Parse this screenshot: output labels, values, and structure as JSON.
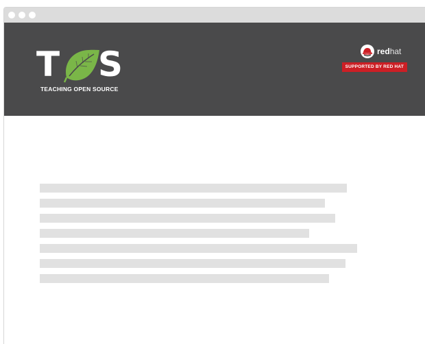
{
  "brand": {
    "logo_letters_left": "T",
    "logo_letters_right": "S",
    "tagline": "TEACHING OPEN SOURCE",
    "leaf_icon": "leaf-icon"
  },
  "sponsor": {
    "name_bold": "red",
    "name_light": "hat",
    "badge": "SUPPORTED BY RED HAT",
    "icon": "redhat-logo-icon"
  },
  "colors": {
    "header_bg": "#4a4a4b",
    "leaf_green": "#7ab648",
    "badge_red": "#cc1f25",
    "placeholder_gray": "#e1e1e1",
    "titlebar": "#dcdcdc"
  },
  "content_placeholder_lines": 7
}
